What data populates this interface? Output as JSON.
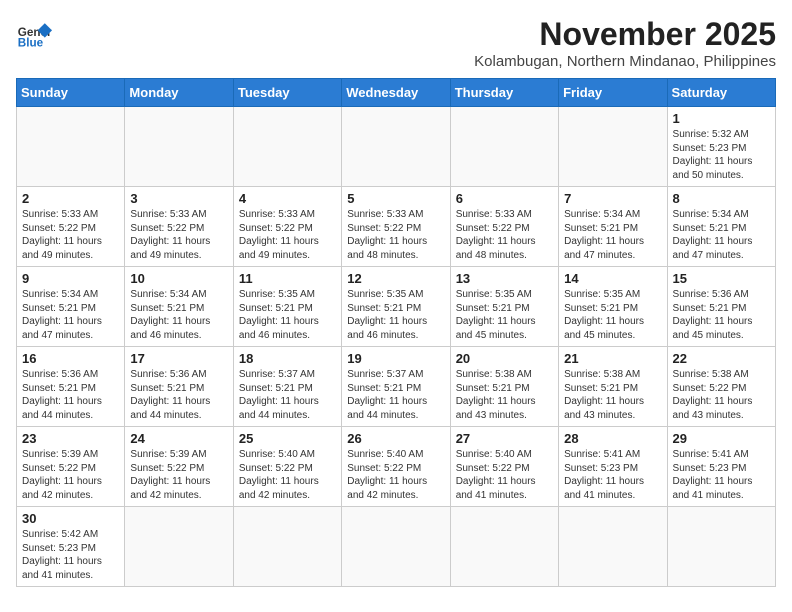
{
  "header": {
    "logo_general": "General",
    "logo_blue": "Blue",
    "title": "November 2025",
    "subtitle": "Kolambugan, Northern Mindanao, Philippines"
  },
  "weekdays": [
    "Sunday",
    "Monday",
    "Tuesday",
    "Wednesday",
    "Thursday",
    "Friday",
    "Saturday"
  ],
  "weeks": [
    [
      {
        "day": "",
        "content": ""
      },
      {
        "day": "",
        "content": ""
      },
      {
        "day": "",
        "content": ""
      },
      {
        "day": "",
        "content": ""
      },
      {
        "day": "",
        "content": ""
      },
      {
        "day": "",
        "content": ""
      },
      {
        "day": "1",
        "content": "Sunrise: 5:32 AM\nSunset: 5:23 PM\nDaylight: 11 hours and 50 minutes."
      }
    ],
    [
      {
        "day": "2",
        "content": "Sunrise: 5:33 AM\nSunset: 5:22 PM\nDaylight: 11 hours and 49 minutes."
      },
      {
        "day": "3",
        "content": "Sunrise: 5:33 AM\nSunset: 5:22 PM\nDaylight: 11 hours and 49 minutes."
      },
      {
        "day": "4",
        "content": "Sunrise: 5:33 AM\nSunset: 5:22 PM\nDaylight: 11 hours and 49 minutes."
      },
      {
        "day": "5",
        "content": "Sunrise: 5:33 AM\nSunset: 5:22 PM\nDaylight: 11 hours and 48 minutes."
      },
      {
        "day": "6",
        "content": "Sunrise: 5:33 AM\nSunset: 5:22 PM\nDaylight: 11 hours and 48 minutes."
      },
      {
        "day": "7",
        "content": "Sunrise: 5:34 AM\nSunset: 5:21 PM\nDaylight: 11 hours and 47 minutes."
      },
      {
        "day": "8",
        "content": "Sunrise: 5:34 AM\nSunset: 5:21 PM\nDaylight: 11 hours and 47 minutes."
      }
    ],
    [
      {
        "day": "9",
        "content": "Sunrise: 5:34 AM\nSunset: 5:21 PM\nDaylight: 11 hours and 47 minutes."
      },
      {
        "day": "10",
        "content": "Sunrise: 5:34 AM\nSunset: 5:21 PM\nDaylight: 11 hours and 46 minutes."
      },
      {
        "day": "11",
        "content": "Sunrise: 5:35 AM\nSunset: 5:21 PM\nDaylight: 11 hours and 46 minutes."
      },
      {
        "day": "12",
        "content": "Sunrise: 5:35 AM\nSunset: 5:21 PM\nDaylight: 11 hours and 46 minutes."
      },
      {
        "day": "13",
        "content": "Sunrise: 5:35 AM\nSunset: 5:21 PM\nDaylight: 11 hours and 45 minutes."
      },
      {
        "day": "14",
        "content": "Sunrise: 5:35 AM\nSunset: 5:21 PM\nDaylight: 11 hours and 45 minutes."
      },
      {
        "day": "15",
        "content": "Sunrise: 5:36 AM\nSunset: 5:21 PM\nDaylight: 11 hours and 45 minutes."
      }
    ],
    [
      {
        "day": "16",
        "content": "Sunrise: 5:36 AM\nSunset: 5:21 PM\nDaylight: 11 hours and 44 minutes."
      },
      {
        "day": "17",
        "content": "Sunrise: 5:36 AM\nSunset: 5:21 PM\nDaylight: 11 hours and 44 minutes."
      },
      {
        "day": "18",
        "content": "Sunrise: 5:37 AM\nSunset: 5:21 PM\nDaylight: 11 hours and 44 minutes."
      },
      {
        "day": "19",
        "content": "Sunrise: 5:37 AM\nSunset: 5:21 PM\nDaylight: 11 hours and 44 minutes."
      },
      {
        "day": "20",
        "content": "Sunrise: 5:38 AM\nSunset: 5:21 PM\nDaylight: 11 hours and 43 minutes."
      },
      {
        "day": "21",
        "content": "Sunrise: 5:38 AM\nSunset: 5:21 PM\nDaylight: 11 hours and 43 minutes."
      },
      {
        "day": "22",
        "content": "Sunrise: 5:38 AM\nSunset: 5:22 PM\nDaylight: 11 hours and 43 minutes."
      }
    ],
    [
      {
        "day": "23",
        "content": "Sunrise: 5:39 AM\nSunset: 5:22 PM\nDaylight: 11 hours and 42 minutes."
      },
      {
        "day": "24",
        "content": "Sunrise: 5:39 AM\nSunset: 5:22 PM\nDaylight: 11 hours and 42 minutes."
      },
      {
        "day": "25",
        "content": "Sunrise: 5:40 AM\nSunset: 5:22 PM\nDaylight: 11 hours and 42 minutes."
      },
      {
        "day": "26",
        "content": "Sunrise: 5:40 AM\nSunset: 5:22 PM\nDaylight: 11 hours and 42 minutes."
      },
      {
        "day": "27",
        "content": "Sunrise: 5:40 AM\nSunset: 5:22 PM\nDaylight: 11 hours and 41 minutes."
      },
      {
        "day": "28",
        "content": "Sunrise: 5:41 AM\nSunset: 5:23 PM\nDaylight: 11 hours and 41 minutes."
      },
      {
        "day": "29",
        "content": "Sunrise: 5:41 AM\nSunset: 5:23 PM\nDaylight: 11 hours and 41 minutes."
      }
    ],
    [
      {
        "day": "30",
        "content": "Sunrise: 5:42 AM\nSunset: 5:23 PM\nDaylight: 11 hours and 41 minutes."
      },
      {
        "day": "",
        "content": ""
      },
      {
        "day": "",
        "content": ""
      },
      {
        "day": "",
        "content": ""
      },
      {
        "day": "",
        "content": ""
      },
      {
        "day": "",
        "content": ""
      },
      {
        "day": "",
        "content": ""
      }
    ]
  ]
}
